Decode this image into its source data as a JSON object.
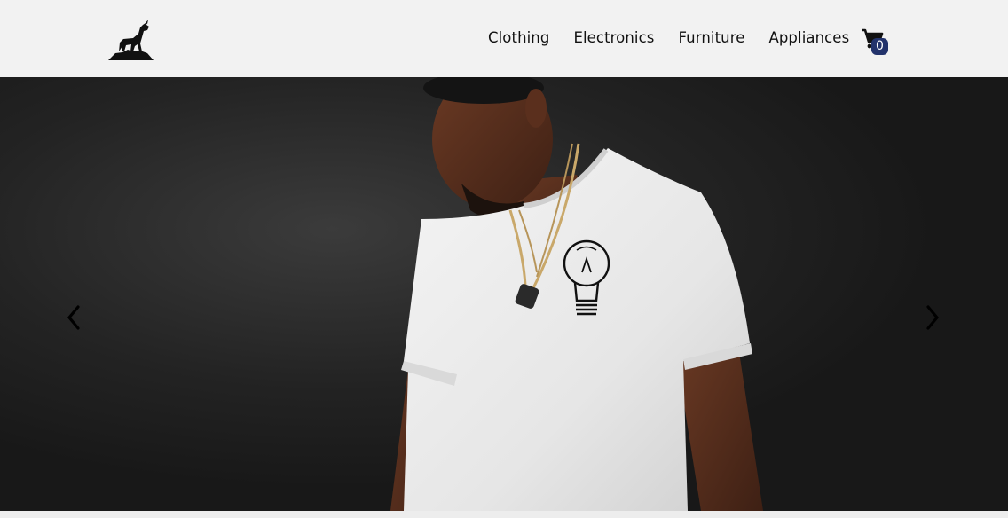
{
  "header": {
    "logo_icon": "goat-logo-icon",
    "nav_items": [
      {
        "label": "Clothing"
      },
      {
        "label": "Electronics"
      },
      {
        "label": "Furniture"
      },
      {
        "label": "Appliances"
      }
    ],
    "cart": {
      "icon": "shopping-cart-icon",
      "count": "0"
    }
  },
  "hero": {
    "image_subject": "man-wearing-white-tshirt-with-lightbulb-print",
    "prev_icon": "chevron-left-icon",
    "next_icon": "chevron-right-icon"
  },
  "colors": {
    "header_bg": "#f2f2f2",
    "hero_bg": "#1e1e1e",
    "badge_bg": "#23336c",
    "text": "#111111"
  }
}
